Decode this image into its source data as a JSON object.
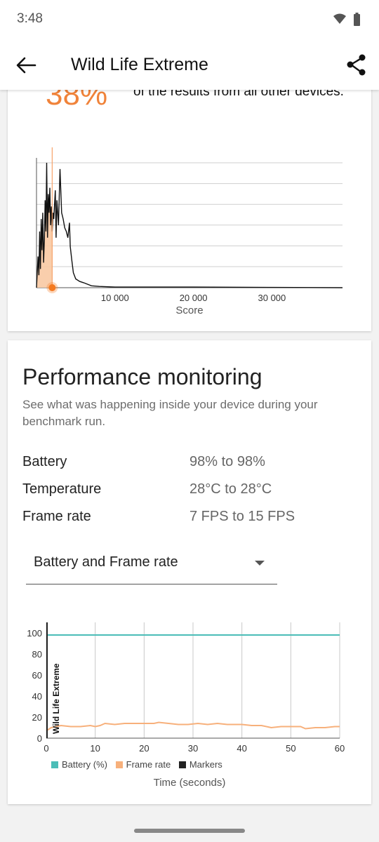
{
  "status_bar": {
    "time": "3:48"
  },
  "app_bar": {
    "title": "Wild Life Extreme"
  },
  "ranking": {
    "percent": "38%",
    "description": "of the results from all other devices."
  },
  "histogram": {
    "xlabel": "Score",
    "tick_labels": [
      "10 000",
      "20 000",
      "30 000"
    ],
    "colors": {
      "line": "#111111",
      "fill": "#f8c9a3",
      "marker": "#f47a20"
    }
  },
  "performance": {
    "title": "Performance monitoring",
    "description": "See what was happening inside your device during your benchmark run.",
    "metrics": [
      {
        "label": "Battery",
        "value": "98% to 98%"
      },
      {
        "label": "Temperature",
        "value": "28°C to 28°C"
      },
      {
        "label": "Frame rate",
        "value": "7 FPS to 15 FPS"
      }
    ],
    "dropdown": {
      "selected": "Battery and Frame rate"
    },
    "chart_label": "Wild Life Extreme",
    "legend": [
      {
        "label": "Battery (%)",
        "color": "#4bbdb7"
      },
      {
        "label": "Frame rate",
        "color": "#f7b07b"
      },
      {
        "label": "Markers",
        "color": "#222222"
      }
    ],
    "xlabel": "Time (seconds)"
  },
  "chart_data": [
    {
      "type": "area",
      "xlabel": "Score",
      "ylabel": "",
      "xlim": [
        0,
        39000
      ],
      "x_ticks": [
        10000,
        20000,
        30000
      ],
      "device_score": 2000,
      "distribution": [
        [
          0,
          0
        ],
        [
          200,
          25
        ],
        [
          300,
          10
        ],
        [
          400,
          45
        ],
        [
          500,
          15
        ],
        [
          600,
          55
        ],
        [
          700,
          30
        ],
        [
          800,
          60
        ],
        [
          900,
          20
        ],
        [
          1000,
          38
        ],
        [
          1100,
          70
        ],
        [
          1200,
          45
        ],
        [
          1300,
          100
        ],
        [
          1400,
          40
        ],
        [
          1500,
          75
        ],
        [
          1600,
          60
        ],
        [
          1700,
          80
        ],
        [
          1800,
          50
        ],
        [
          1900,
          65
        ],
        [
          2000,
          45
        ],
        [
          2100,
          60
        ],
        [
          2200,
          55
        ],
        [
          2400,
          78
        ],
        [
          2500,
          40
        ],
        [
          2600,
          70
        ],
        [
          2800,
          50
        ],
        [
          3000,
          95
        ],
        [
          3200,
          60
        ],
        [
          3400,
          55
        ],
        [
          3600,
          48
        ],
        [
          3800,
          45
        ],
        [
          4000,
          40
        ],
        [
          4200,
          52
        ],
        [
          4300,
          33
        ],
        [
          4500,
          22
        ],
        [
          4700,
          12
        ],
        [
          5000,
          7
        ],
        [
          5500,
          5
        ],
        [
          6000,
          4
        ],
        [
          7000,
          1.5
        ],
        [
          8000,
          1
        ],
        [
          10000,
          0.5
        ],
        [
          20000,
          0.5
        ],
        [
          30000,
          0.2
        ],
        [
          39000,
          0
        ]
      ],
      "grid": true
    },
    {
      "type": "line",
      "xlabel": "Time (seconds)",
      "ylabel": "",
      "xlim": [
        0,
        60
      ],
      "ylim": [
        0,
        110
      ],
      "x_ticks": [
        0,
        10,
        20,
        30,
        40,
        50,
        60
      ],
      "y_ticks": [
        0,
        20,
        40,
        60,
        80,
        100
      ],
      "series": [
        {
          "name": "Battery (%)",
          "color": "#4bbdb7",
          "x": [
            0,
            60
          ],
          "y": [
            98,
            98
          ]
        },
        {
          "name": "Frame rate",
          "color": "#f7b07b",
          "x": [
            0,
            1,
            2,
            3,
            5,
            7,
            9,
            10,
            11,
            12,
            14,
            16,
            18,
            20,
            22,
            23,
            25,
            27,
            29,
            31,
            33,
            35,
            37,
            39,
            40,
            42,
            44,
            46,
            48,
            50,
            52,
            53,
            55,
            57,
            59,
            60
          ],
          "y": [
            7,
            10,
            11,
            12,
            11,
            11,
            12,
            11,
            12,
            14,
            13,
            14,
            14,
            14,
            14,
            15,
            14,
            13,
            13,
            14,
            13,
            14,
            13,
            13,
            13,
            12,
            12,
            10,
            11,
            11,
            11,
            9,
            10,
            10,
            11,
            11
          ]
        }
      ],
      "legend_position": "bottom",
      "grid": true
    }
  ]
}
